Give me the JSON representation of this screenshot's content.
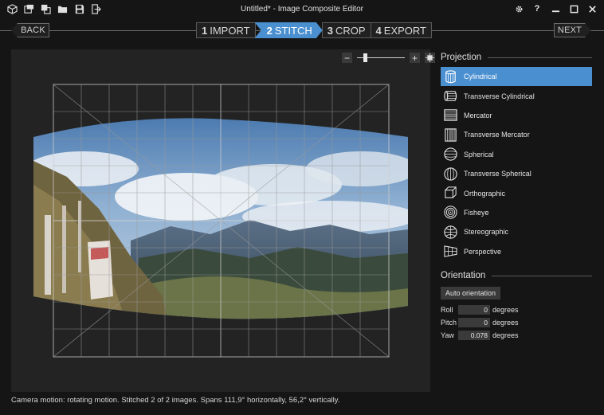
{
  "window": {
    "title": "Untitled* - Image Composite Editor"
  },
  "toolbar": {
    "icons": [
      "new-project-icon",
      "new-panorama-icon",
      "new-composite-icon",
      "open-icon",
      "save-icon",
      "export-icon"
    ]
  },
  "window_controls": {
    "settings_icon": "gear-icon",
    "help_label": "?"
  },
  "steps": {
    "back_label": "BACK",
    "next_label": "NEXT",
    "items": [
      {
        "num": "1",
        "label": "IMPORT"
      },
      {
        "num": "2",
        "label": "STITCH"
      },
      {
        "num": "3",
        "label": "CROP"
      },
      {
        "num": "4",
        "label": "EXPORT"
      }
    ],
    "active": "STITCH"
  },
  "zoom": {
    "minus": "−",
    "plus": "+",
    "level": 0.15
  },
  "status": {
    "text": "Camera motion: rotating motion. Stitched 2 of 2 images. Spans 111,9° horizontally, 56,2° vertically."
  },
  "projection": {
    "title": "Projection",
    "items": [
      {
        "label": "Cylindrical",
        "icon": "cylindrical-icon"
      },
      {
        "label": "Transverse Cylindrical",
        "icon": "transverse-cylindrical-icon"
      },
      {
        "label": "Mercator",
        "icon": "mercator-icon"
      },
      {
        "label": "Transverse Mercator",
        "icon": "transverse-mercator-icon"
      },
      {
        "label": "Spherical",
        "icon": "spherical-icon"
      },
      {
        "label": "Transverse Spherical",
        "icon": "transverse-spherical-icon"
      },
      {
        "label": "Orthographic",
        "icon": "orthographic-icon"
      },
      {
        "label": "Fisheye",
        "icon": "fisheye-icon"
      },
      {
        "label": "Stereographic",
        "icon": "stereographic-icon"
      },
      {
        "label": "Perspective",
        "icon": "perspective-icon"
      }
    ],
    "selected": "Cylindrical"
  },
  "orientation": {
    "title": "Orientation",
    "auto_label": "Auto orientation",
    "roll": {
      "label": "Roll",
      "value": "0",
      "unit": "degrees"
    },
    "pitch": {
      "label": "Pitch",
      "value": "0",
      "unit": "degrees"
    },
    "yaw": {
      "label": "Yaw",
      "value": "0.078",
      "unit": "degrees"
    }
  },
  "colors": {
    "accent": "#4a8fd0",
    "background": "#151515",
    "canvas": "#232323"
  }
}
